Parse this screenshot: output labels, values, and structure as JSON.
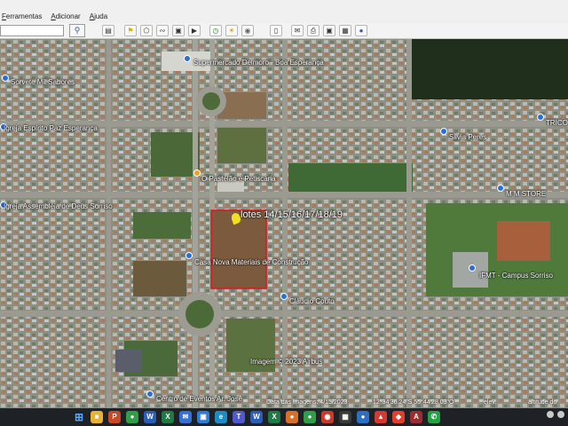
{
  "menu": {
    "items": [
      "Ferramentas",
      "Adicionar",
      "Ajuda"
    ]
  },
  "toolbar": {
    "search_placeholder": "",
    "icons": [
      "sidebar-icon",
      "placemark-icon",
      "polygon-icon",
      "path-icon",
      "overlay-icon",
      "tour-icon",
      "history-icon",
      "sun-icon",
      "planet-icon",
      "ruler-icon",
      "email-icon",
      "print-icon",
      "save-image-icon",
      "map-icon",
      "earth-icon"
    ]
  },
  "map": {
    "places": [
      {
        "name": "Supermercado Delmoro - Boa Esperança",
        "color": "#2a6fd6"
      },
      {
        "name": "Sorvete Mil Sabores",
        "color": "#2a6fd6"
      },
      {
        "name": "Igreja Espírito Paz Esperança",
        "color": "#2a6fd6"
      },
      {
        "name": "Silvia Peres",
        "color": "#2a6fd6"
      },
      {
        "name": "TRICO",
        "color": "#2a6fd6"
      },
      {
        "name": "O Pastelão e Petiscaria",
        "color": "#f0a020"
      },
      {
        "name": "M M STORE",
        "color": "#2a6fd6"
      },
      {
        "name": "Igreja Assembléia de Deus Sorriso",
        "color": "#2a6fd6"
      },
      {
        "name": "Casa Nova Materiais de Construção",
        "color": "#2a6fd6"
      },
      {
        "name": "IFMT - Campus Sorriso",
        "color": "#2a6fd6"
      },
      {
        "name": "Cláudio Couto",
        "color": "#2a6fd6"
      },
      {
        "name": "Centro de Eventos Ar. José",
        "color": "#2a6fd6"
      }
    ],
    "lot_label": "lotes 14/15/16/17/18/19",
    "imagery_credit": "Imagem © 2023 Airbus"
  },
  "status": {
    "date_text": "Data das imagens: 4/15/2023",
    "coords": "12°34'36.24\"S  55°44'28.03\"O",
    "elev": "elev.",
    "altitude": "altitude do"
  },
  "taskbar": {
    "apps": [
      "start",
      "files",
      "powerpoint",
      "chrome",
      "word",
      "excel",
      "mail",
      "photos",
      "edge",
      "teams",
      "word2",
      "excel2",
      "photos2",
      "chrome2",
      "maps",
      "store",
      "earth",
      "pdf",
      "anydesk",
      "app",
      "whatsapp"
    ]
  }
}
